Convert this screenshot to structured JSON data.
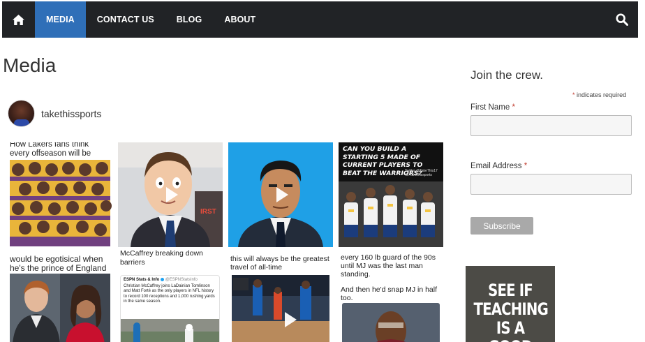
{
  "nav": {
    "items": [
      {
        "label": "MEDIA",
        "active": true
      },
      {
        "label": "CONTACT US",
        "active": false
      },
      {
        "label": "BLOG",
        "active": false
      },
      {
        "label": "ABOUT",
        "active": false
      }
    ],
    "home_icon": "home-icon",
    "search_icon": "search-icon",
    "bg_color": "#212326",
    "active_color": "#2f6fb8"
  },
  "page": {
    "title": "Media"
  },
  "instagram": {
    "handle": "takethissports",
    "posts": [
      {
        "caption": "How Lakers fans think every offseason will be",
        "type": "image"
      },
      {
        "caption": "",
        "type": "video"
      },
      {
        "caption": "",
        "type": "video"
      },
      {
        "caption": "CAN YOU BUILD A STARTING 5 MADE OF CURRENT PLAYERS TO BEAT THE WARRIORS?",
        "credit": "Twitter @TakeThis17 IG: takethissports",
        "type": "image"
      },
      {
        "caption": "would be egotisical when he's the prince of England",
        "type": "image"
      },
      {
        "caption": "McCaffrey breaking down barriers",
        "tweet_source": "ESPN Stats & Info",
        "tweet_handle": "@ESPNStatsInfo",
        "tweet_text": "Christian McCaffrey joins LaDainian Tomlinson and Matt Forté as the only players in NFL history to record 100 receptions and 1,000 rushing yards in the same season.",
        "type": "image"
      },
      {
        "caption": "this will always be the greatest travel of all-time",
        "type": "video"
      },
      {
        "caption_top": "every 160 lb guard of the 90s until MJ was the last man standing.",
        "caption_bottom": "And then he'd snap MJ in half too.",
        "type": "image"
      }
    ]
  },
  "signup": {
    "title": "Join the crew.",
    "required_note": "indicates required",
    "required_star": "*",
    "first_name_label": "First Name",
    "email_label": "Email Address",
    "first_name_value": "",
    "email_value": "",
    "subscribe_label": "Subscribe"
  },
  "ad": {
    "text": "SEE IF TEACHING IS A GOOD"
  }
}
